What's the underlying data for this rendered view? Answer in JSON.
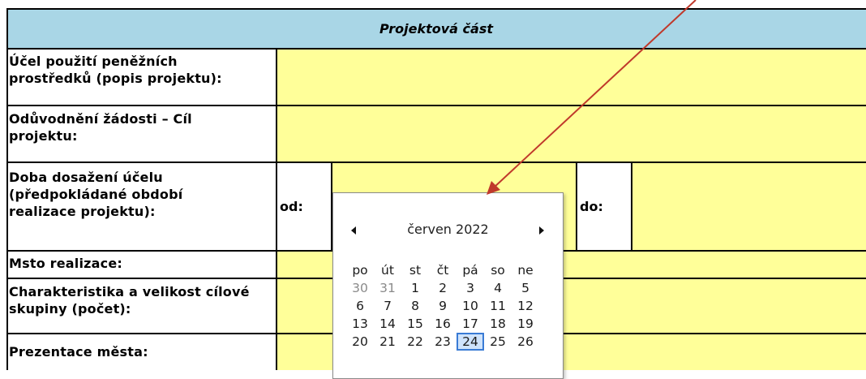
{
  "header": {
    "title": "Projektová část"
  },
  "rows": {
    "ucel": [
      "Účel použití peněžních",
      "prostředků (popis projektu):"
    ],
    "oduvodneni": [
      "Odůvodnění žádosti – Cíl",
      "projektu:"
    ],
    "doba": [
      "Doba dosažení účelu",
      "(předpokládané období",
      "realizace projektu):"
    ],
    "misto": [
      "Msto realizace:"
    ],
    "charakteristika": [
      "Charakteristika a velikost cílové",
      "skupiny (počet):"
    ],
    "prezentace": [
      "Prezentace města:"
    ]
  },
  "od_label": "od:",
  "do_label": "do:",
  "calendar": {
    "month_label": "červen 2022",
    "weekday_headers": [
      "po",
      "út",
      "st",
      "čt",
      "pá",
      "so",
      "ne"
    ],
    "weeks": [
      [
        "30",
        "31",
        "1",
        "2",
        "3",
        "4",
        "5"
      ],
      [
        "6",
        "7",
        "8",
        "9",
        "10",
        "11",
        "12"
      ],
      [
        "13",
        "14",
        "15",
        "16",
        "17",
        "18",
        "19"
      ],
      [
        "20",
        "21",
        "22",
        "23",
        "24",
        "25",
        "26"
      ]
    ],
    "previous_month_days": [
      "30",
      "31"
    ],
    "today": "24"
  },
  "colors": {
    "header_bg": "#a9d6e6",
    "input_bg": "#ffff99",
    "arrow": "#c0392b",
    "today_outline": "#3a7bd5"
  }
}
